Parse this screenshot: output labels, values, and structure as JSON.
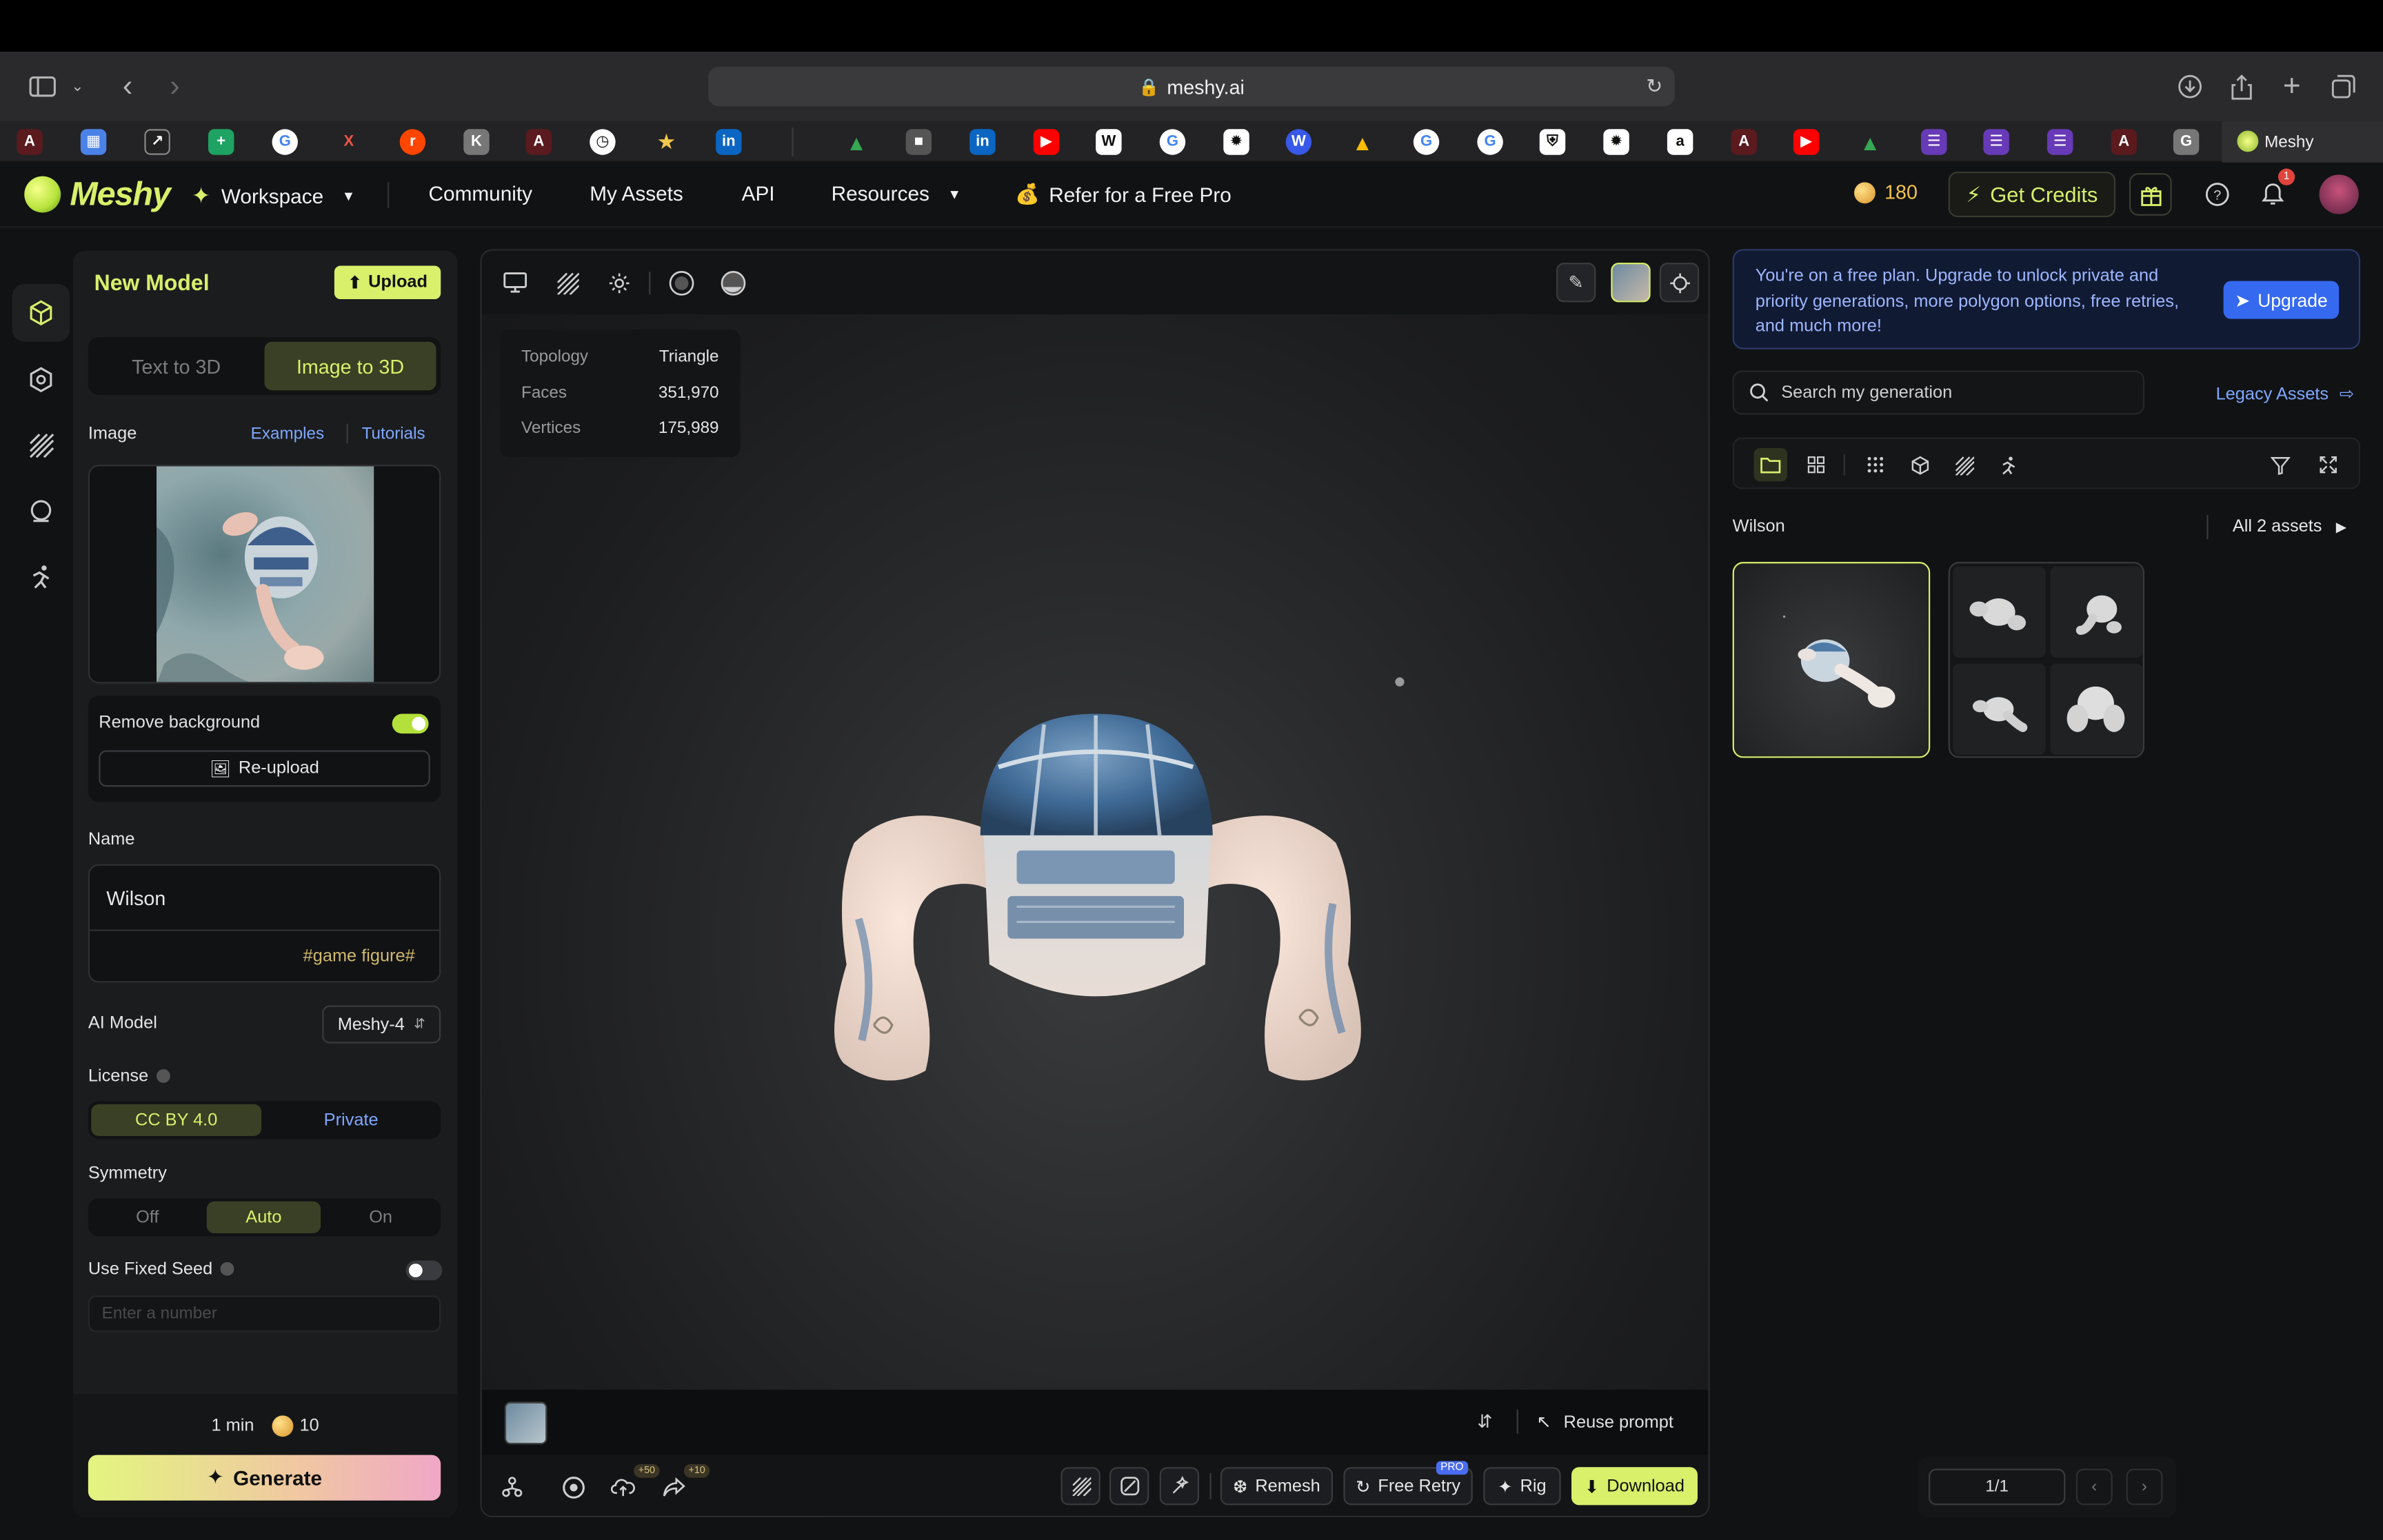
{
  "browser": {
    "url": "meshy.ai",
    "active_tab_label": "Meshy",
    "bookmark_icons": [
      "tamu-icon",
      "docs-icon",
      "overleaf-icon",
      "sheets-icon",
      "google-icon",
      "x-icon",
      "reddit-icon",
      "k-icon",
      "tamu-icon",
      "clock-icon",
      "star-icon",
      "linkedin-icon",
      "drive-icon",
      "cube-icon",
      "linkedin-icon",
      "youtube-icon",
      "wiki-icon",
      "google-icon",
      "chatgpt-icon",
      "wordpress-icon",
      "drive-icon",
      "google-icon",
      "google-icon",
      "shield-icon",
      "chatgpt-icon",
      "amazon-icon",
      "tamu-icon",
      "youtube-icon",
      "drive-icon",
      "forms-icon",
      "forms-icon",
      "forms-icon",
      "tamu-icon",
      "g-icon"
    ]
  },
  "header": {
    "logo_text": "Meshy",
    "workspace_label": "Workspace",
    "nav": [
      "Community",
      "My Assets",
      "API",
      "Resources"
    ],
    "refer_label": "Refer for a Free Pro",
    "credits_value": "180",
    "get_credits_label": "Get Credits",
    "notification_count": "1"
  },
  "left_panel": {
    "title": "New Model",
    "upload_label": "Upload",
    "tabs": [
      "Text to 3D",
      "Image to 3D"
    ],
    "active_tab": "Image to 3D",
    "image_label": "Image",
    "examples_link": "Examples",
    "tutorials_link": "Tutorials",
    "remove_background_label": "Remove background",
    "remove_background_on": true,
    "reupload_label": "Re-upload",
    "name_label": "Name",
    "name_value": "Wilson",
    "tag_value": "#game figure#",
    "ai_model_label": "AI Model",
    "ai_model_value": "Meshy-4",
    "license_label": "License",
    "license_options": [
      "CC BY 4.0",
      "Private"
    ],
    "symmetry_label": "Symmetry",
    "symmetry_options": [
      "Off",
      "Auto",
      "On"
    ],
    "fixed_seed_label": "Use Fixed Seed",
    "seed_placeholder": "Enter a number",
    "time_estimate": "1 min",
    "cost": "10",
    "generate_label": "Generate"
  },
  "viewer": {
    "stats": [
      {
        "key": "Topology",
        "value": "Triangle"
      },
      {
        "key": "Faces",
        "value": "351,970"
      },
      {
        "key": "Vertices",
        "value": "175,989"
      }
    ],
    "reuse_prompt_label": "Reuse prompt",
    "bonus_1": "+50",
    "bonus_2": "+10",
    "remesh_label": "Remesh",
    "free_retry_label": "Free Retry",
    "pro_badge": "PRO",
    "rig_label": "Rig",
    "download_label": "Download"
  },
  "right_panel": {
    "banner_text": "You're on a free plan. Upgrade to unlock private and priority generations, more polygon options, free retries, and much more!",
    "upgrade_label": "Upgrade",
    "search_placeholder": "Search my generation",
    "legacy_assets_label": "Legacy Assets",
    "group_label": "Wilson",
    "all_assets_label": "All 2 assets",
    "pager_value": "1/1"
  },
  "colors": {
    "accent": "#d8f06a",
    "link": "#7fa7ff",
    "upgrade": "#3569f0",
    "background": "#111214"
  }
}
